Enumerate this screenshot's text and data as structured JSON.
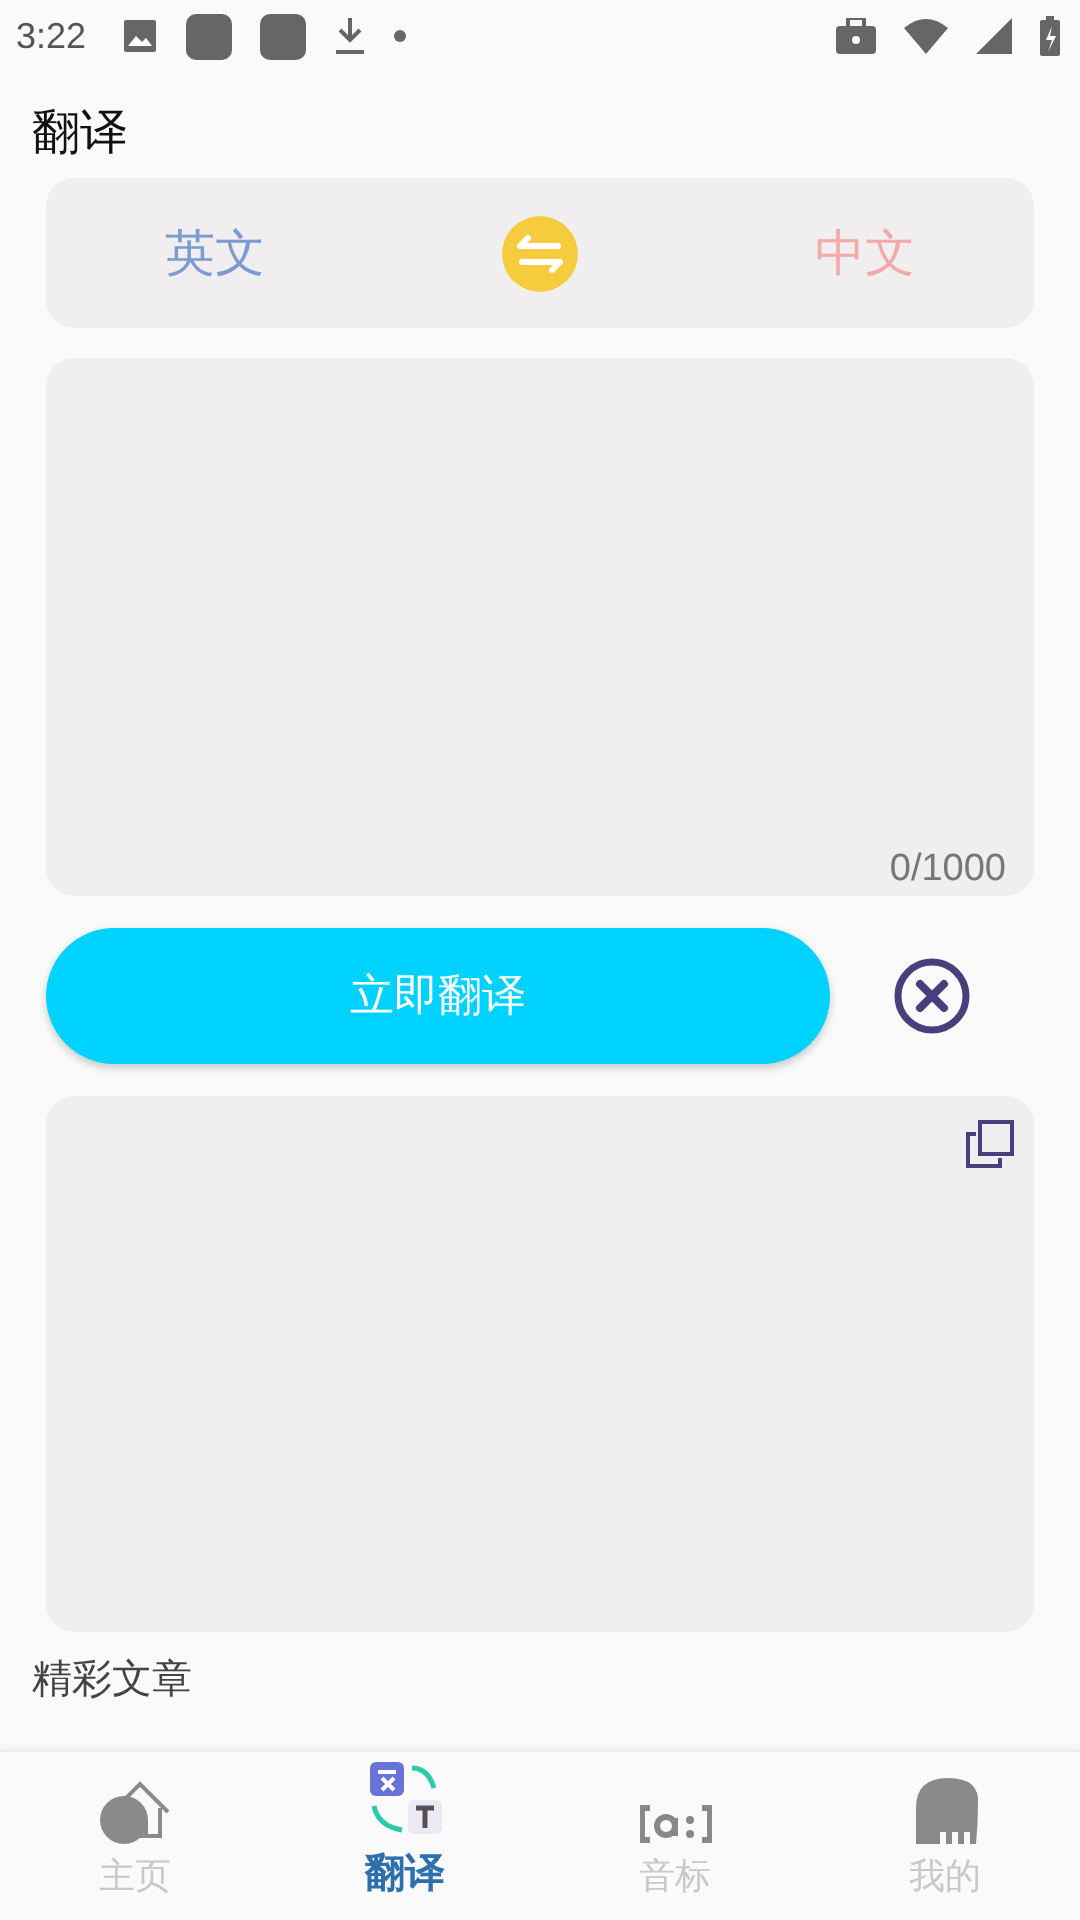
{
  "status_bar": {
    "time": "3:22"
  },
  "title": "翻译",
  "languages": {
    "source": "英文",
    "target": "中文"
  },
  "input": {
    "counter": "0/1000"
  },
  "translate_button": "立即翻译",
  "section_heading": "精彩文章",
  "nav": [
    {
      "label": "主页",
      "kind": "home",
      "selected": false
    },
    {
      "label": "翻译",
      "kind": "translate",
      "selected": true
    },
    {
      "label": "音标",
      "kind": "phonetic",
      "selected": false
    },
    {
      "label": "我的",
      "kind": "profile",
      "selected": false
    }
  ]
}
